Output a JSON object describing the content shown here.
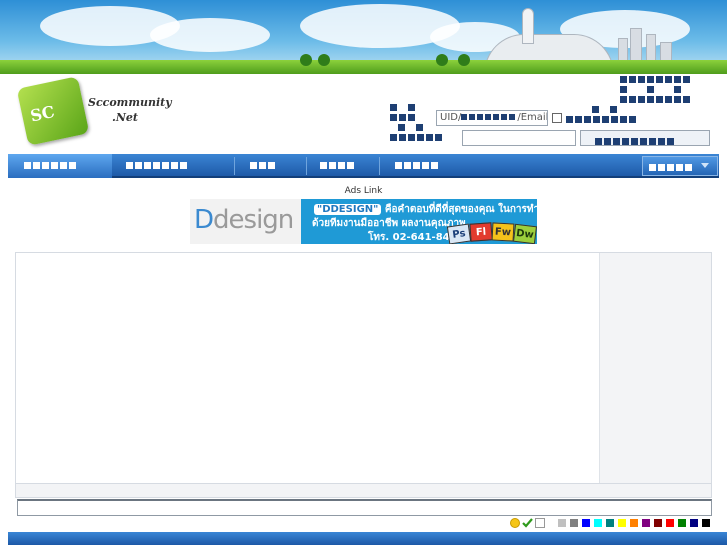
{
  "login": {
    "uid_label": "UID/",
    "email_label": "/Email",
    "password_value": ""
  },
  "ads": {
    "label": "Ads Link",
    "banner": {
      "logo_d": "D",
      "logo_rest": "design",
      "tag": "\"DDESIGN\"",
      "line1": "คือคำตอบที่ดีที่สุดของคุณ ในการทำเว็บไซต์",
      "line2": "ด้วยทีมงานมืออาชีพ  ผลงานคุณภาพ",
      "phone": "โทร. 02-641-8400",
      "apps": [
        "Ps",
        "Fl",
        "Fw",
        "Dw"
      ]
    }
  },
  "colors": {
    "nav_blue": "#1e5aa8",
    "accent": "#3b85d4",
    "swatches": [
      "#c0c0c0",
      "#808080",
      "#0000ff",
      "#00ffff",
      "#008080",
      "#ffff00",
      "#ff8000",
      "#800080",
      "#800000",
      "#ff0000",
      "#008000",
      "#000080",
      "#000000"
    ]
  },
  "icons": [
    "smiley-icon",
    "checkmark-icon",
    "blank-square-icon"
  ]
}
